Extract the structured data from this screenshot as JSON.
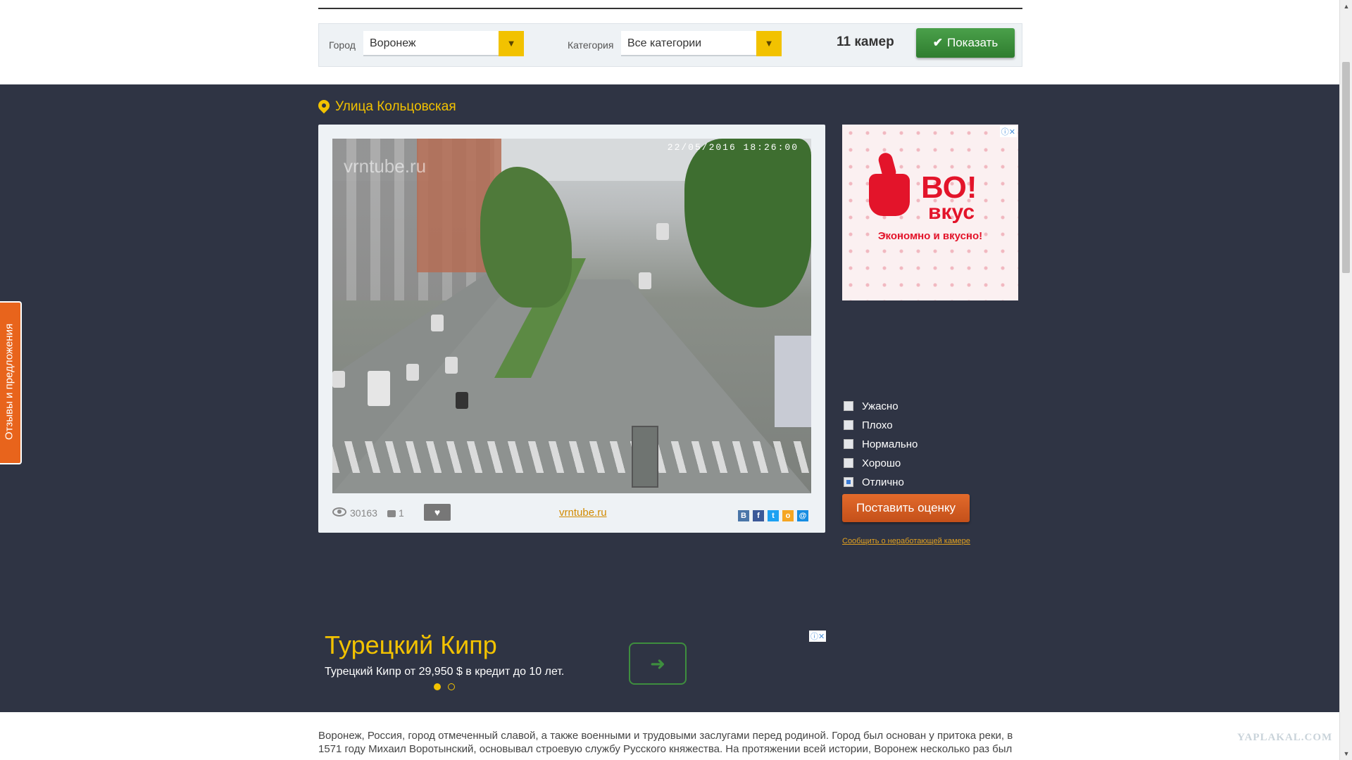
{
  "filter": {
    "city_label": "Город",
    "city_value": "Воронеж",
    "category_label": "Категория",
    "category_value": "Все категории",
    "cam_count": "11 камер",
    "show_button": "Показать"
  },
  "camera": {
    "title": "Улица Кольцовская",
    "watermark": "vrntube.ru",
    "timestamp": "22/05/2016  18:26:00",
    "views": "30163",
    "comments": "1",
    "source_link": "vrntube.ru",
    "shares": [
      "В",
      "f",
      "t",
      "o",
      "@"
    ]
  },
  "ad": {
    "brand_line1": "ВО!",
    "brand_line2": "вкус",
    "tagline": "Экономно и вкусно!"
  },
  "rating": {
    "options": [
      {
        "label": "Ужасно",
        "checked": false
      },
      {
        "label": "Плохо",
        "checked": false
      },
      {
        "label": "Нормально",
        "checked": false
      },
      {
        "label": "Хорошо",
        "checked": false
      },
      {
        "label": "Отлично",
        "checked": true
      }
    ],
    "submit_label": "Поставить оценку",
    "report_link": "Сообщить о неработающей камере"
  },
  "promo": {
    "title": "Турецкий Кипр",
    "subtitle": "Турецкий Кипр от 29,950 $ в кредит до 10 лет."
  },
  "description": "Воронеж, Россия, город отмеченный славой, а также военными и трудовыми заслугами перед родиной. Город был основан у притока реки, в 1571 году Михаил Воротынский, основывал строевую службу Русского княжества. На протяжении всей истории, Воронеж несколько раз был",
  "side_tab": "Отзывы и предложения",
  "watermark_site": "YAPLAKAL.COM",
  "colors": {
    "accent": "#f2c200",
    "dark_bg": "#2f3444",
    "show_button": "#3a8a3a",
    "rate_button": "#d45a20",
    "side_tab": "#e8641c"
  }
}
